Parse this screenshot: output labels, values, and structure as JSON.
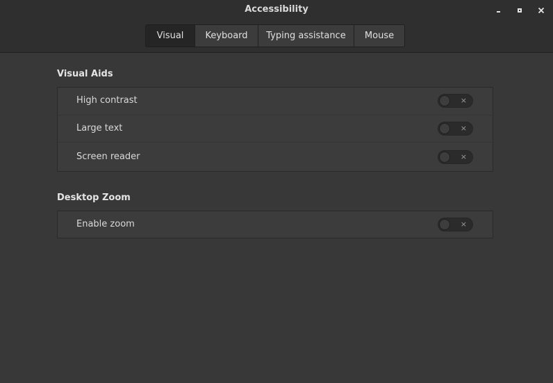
{
  "window": {
    "title": "Accessibility"
  },
  "tabs": [
    {
      "label": "Visual",
      "active": true
    },
    {
      "label": "Keyboard",
      "active": false
    },
    {
      "label": "Typing assistance",
      "active": false
    },
    {
      "label": "Mouse",
      "active": false
    }
  ],
  "sections": {
    "visual_aids": {
      "heading": "Visual Aids",
      "items": [
        {
          "label": "High contrast",
          "enabled": false,
          "switch_glyph": "×"
        },
        {
          "label": "Large text",
          "enabled": false,
          "switch_glyph": "×"
        },
        {
          "label": "Screen reader",
          "enabled": false,
          "switch_glyph": "×"
        }
      ]
    },
    "desktop_zoom": {
      "heading": "Desktop Zoom",
      "items": [
        {
          "label": "Enable zoom",
          "enabled": false,
          "switch_glyph": "×"
        }
      ]
    }
  },
  "icons": {
    "minimize": "minimize-icon",
    "maximize": "maximize-icon",
    "close": "close-icon"
  },
  "colors": {
    "background": "#383838",
    "headerbar": "#2f2f2f",
    "panel": "#3c3c3c",
    "active_tab": "#252525"
  }
}
